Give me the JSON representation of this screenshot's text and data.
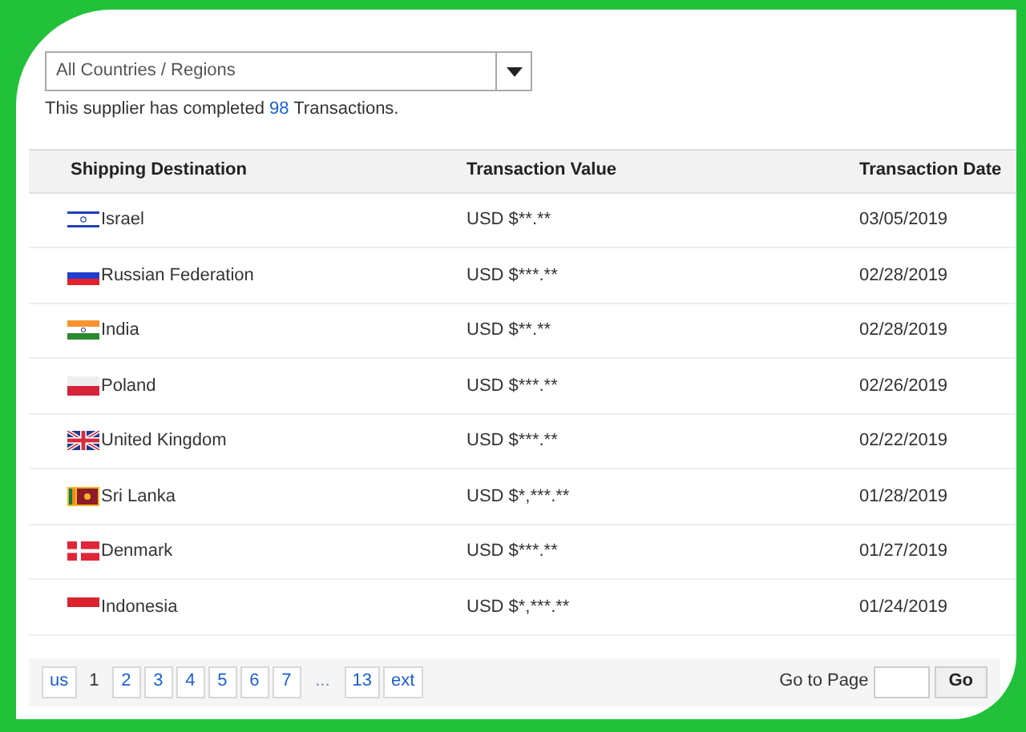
{
  "filter": {
    "value": "All Countries / Regions"
  },
  "summary": {
    "before": "This supplier has completed ",
    "count": "98",
    "after": " Transactions."
  },
  "table": {
    "columns": [
      "Shipping Destination",
      "Transaction Value",
      "Transaction Date"
    ],
    "rows": [
      {
        "kind": "israel",
        "destination": "Israel",
        "value": "USD $**.**",
        "date": "03/05/2019"
      },
      {
        "kind": "russia",
        "destination": "Russian Federation",
        "value": "USD $***.**",
        "date": "02/28/2019"
      },
      {
        "kind": "india",
        "destination": "India",
        "value": "USD $**.**",
        "date": "02/28/2019"
      },
      {
        "kind": "poland",
        "destination": "Poland",
        "value": "USD $***.**",
        "date": "02/26/2019"
      },
      {
        "kind": "uk",
        "destination": "United Kingdom",
        "value": "USD $***.**",
        "date": "02/22/2019"
      },
      {
        "kind": "srilanka",
        "destination": "Sri Lanka",
        "value": "USD $*,***.**",
        "date": "01/28/2019"
      },
      {
        "kind": "denmark",
        "destination": "Denmark",
        "value": "USD $***.**",
        "date": "01/27/2019"
      },
      {
        "kind": "indonesia",
        "destination": "Indonesia",
        "value": "USD $*,***.**",
        "date": "01/24/2019"
      }
    ]
  },
  "pagination": {
    "pages": [
      {
        "label": "us",
        "kind": "prev"
      },
      {
        "label": "1",
        "kind": "page",
        "selected": true
      },
      {
        "label": "2",
        "kind": "page",
        "selected": false
      },
      {
        "label": "3",
        "kind": "page",
        "selected": false
      },
      {
        "label": "4",
        "kind": "page",
        "selected": false
      },
      {
        "label": "5",
        "kind": "page",
        "selected": false
      },
      {
        "label": "6",
        "kind": "page",
        "selected": false
      },
      {
        "label": "7",
        "kind": "page",
        "selected": false
      },
      {
        "label": "...",
        "kind": "gap"
      },
      {
        "label": "13",
        "kind": "page",
        "selected": false
      },
      {
        "label": "ext",
        "kind": "next"
      }
    ],
    "goto_label": "Go to Page",
    "go_button": "Go"
  }
}
